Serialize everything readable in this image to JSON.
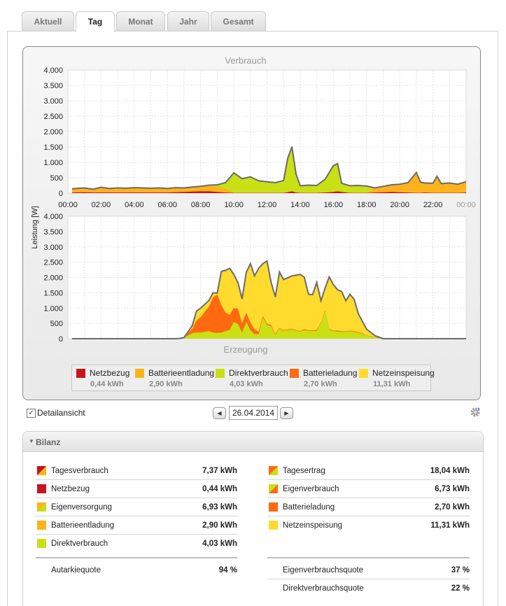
{
  "tabs": [
    "Aktuell",
    "Tag",
    "Monat",
    "Jahr",
    "Gesamt"
  ],
  "active_tab": 1,
  "colors": {
    "netzbezug": "#c8141c",
    "batterieentladung": "#ffb31a",
    "direktverbrauch": "#c9e014",
    "batterieladung": "#ff6a10",
    "netzeinspeisung": "#ffdb2e",
    "total_line": "#6b6b6b"
  },
  "chart": {
    "title_top": "Verbrauch",
    "title_bottom": "Erzeugung",
    "ylabel": "Leistung [W]",
    "legend": [
      {
        "name": "Netzbezug",
        "value": "0,44 kWh",
        "color": "#c8141c"
      },
      {
        "name": "Batterieentladung",
        "value": "2,90 kWh",
        "color": "#ffb31a"
      },
      {
        "name": "Direktverbrauch",
        "value": "4,03 kWh",
        "color": "#c9e014"
      },
      {
        "name": "Batterieladung",
        "value": "2,70 kWh",
        "color": "#ff6a10"
      },
      {
        "name": "Netzeinspeisung",
        "value": "11,31 kWh",
        "color": "#ffdb2e"
      }
    ]
  },
  "chart_data": [
    {
      "type": "area",
      "title": "Verbrauch",
      "ylabel": "Leistung [W]",
      "xlabel": "",
      "x_ticks": [
        "00:00",
        "02:00",
        "04:00",
        "06:00",
        "08:00",
        "10:00",
        "12:00",
        "14:00",
        "16:00",
        "18:00",
        "20:00",
        "22:00",
        "00:00"
      ],
      "y_ticks": [
        "0",
        "500",
        "1.000",
        "1.500",
        "2.000",
        "2.500",
        "3.000",
        "3.500",
        "4.000"
      ],
      "ylim": [
        0,
        4000
      ],
      "xlim_hours": [
        0,
        24
      ],
      "grid": true,
      "stacked": true,
      "x": [
        0.25,
        1,
        1.5,
        2,
        2.5,
        3,
        3.5,
        4,
        4.5,
        5,
        5.5,
        6,
        6.5,
        7,
        7.5,
        8,
        8.5,
        9,
        9.5,
        10,
        10.5,
        11,
        11.5,
        12,
        12.5,
        13,
        13.25,
        13.5,
        13.75,
        14,
        14.5,
        15,
        15.5,
        16,
        16.25,
        16.5,
        17,
        17.5,
        18,
        18.5,
        19,
        19.5,
        20,
        20.5,
        21,
        21.25,
        21.5,
        22,
        22.25,
        22.5,
        23,
        23.5,
        24
      ],
      "series": [
        {
          "name": "Netzbezug",
          "values": [
            20,
            30,
            20,
            20,
            20,
            20,
            20,
            20,
            20,
            20,
            20,
            20,
            30,
            40,
            50,
            60,
            60,
            40,
            20,
            10,
            10,
            10,
            10,
            10,
            10,
            10,
            30,
            60,
            20,
            10,
            10,
            10,
            20,
            40,
            60,
            40,
            10,
            10,
            10,
            20,
            30,
            40,
            30,
            20,
            10,
            10,
            20,
            10,
            10,
            10,
            10,
            10,
            20
          ]
        },
        {
          "name": "Batterieentladung",
          "values": [
            120,
            140,
            110,
            170,
            130,
            150,
            140,
            160,
            150,
            140,
            150,
            130,
            150,
            130,
            150,
            150,
            170,
            150,
            120,
            0,
            0,
            0,
            0,
            0,
            0,
            0,
            0,
            0,
            0,
            0,
            0,
            0,
            0,
            0,
            0,
            0,
            0,
            0,
            0,
            150,
            190,
            230,
            260,
            320,
            660,
            350,
            310,
            310,
            540,
            300,
            320,
            280,
            350
          ]
        },
        {
          "name": "Direktverbrauch",
          "values": [
            0,
            0,
            0,
            0,
            0,
            0,
            0,
            0,
            0,
            0,
            0,
            0,
            0,
            0,
            0,
            10,
            30,
            80,
            200,
            650,
            460,
            520,
            390,
            360,
            330,
            400,
            1100,
            1450,
            600,
            230,
            250,
            240,
            430,
            850,
            900,
            280,
            230,
            240,
            220,
            0,
            0,
            0,
            0,
            0,
            0,
            0,
            0,
            0,
            0,
            0,
            0,
            0,
            0
          ]
        }
      ]
    },
    {
      "type": "area",
      "title": "Erzeugung",
      "ylabel": "Leistung [W]",
      "xlabel": "",
      "y_ticks": [
        "0",
        "500",
        "1.000",
        "1.500",
        "2.000",
        "2.500",
        "3.000",
        "3.500",
        "4.000"
      ],
      "ylim": [
        0,
        4000
      ],
      "xlim_hours": [
        0,
        24
      ],
      "grid": true,
      "stacked": true,
      "x": [
        0.25,
        6.5,
        6.75,
        7,
        7.5,
        7.75,
        8,
        8.5,
        8.75,
        9,
        9.25,
        9.5,
        9.75,
        10,
        10.25,
        10.5,
        10.75,
        11,
        11.25,
        11.5,
        11.75,
        12,
        12.25,
        12.5,
        12.75,
        13,
        13.5,
        14,
        14.25,
        14.5,
        14.75,
        15,
        15.25,
        15.5,
        15.75,
        16,
        16.25,
        16.5,
        16.75,
        17,
        17.25,
        17.5,
        17.75,
        18,
        18.5,
        19,
        20,
        22,
        24
      ],
      "series": [
        {
          "name": "Direktverbrauch",
          "values": [
            0,
            0,
            10,
            40,
            180,
            200,
            200,
            250,
            200,
            190,
            200,
            250,
            280,
            550,
            480,
            200,
            550,
            280,
            150,
            150,
            700,
            450,
            400,
            130,
            330,
            260,
            300,
            230,
            280,
            260,
            250,
            260,
            520,
            900,
            300,
            250,
            240,
            220,
            230,
            240,
            220,
            200,
            150,
            100,
            50,
            0,
            0,
            0,
            0
          ]
        },
        {
          "name": "Batterieladung",
          "values": [
            0,
            0,
            0,
            0,
            150,
            400,
            500,
            800,
            1150,
            1250,
            900,
            600,
            500,
            450,
            500,
            300,
            300,
            250,
            150,
            80,
            50,
            40,
            40,
            30,
            20,
            20,
            20,
            20,
            30,
            20,
            20,
            30,
            20,
            20,
            20,
            20,
            30,
            20,
            20,
            20,
            20,
            20,
            20,
            10,
            10,
            0,
            0,
            0,
            0
          ]
        },
        {
          "name": "Netzeinspeisung",
          "values": [
            0,
            0,
            0,
            0,
            100,
            300,
            300,
            200,
            150,
            50,
            1100,
            1380,
            1520,
            1100,
            850,
            800,
            1320,
            1920,
            1750,
            2070,
            1700,
            2050,
            1400,
            1200,
            1830,
            1650,
            1730,
            1850,
            1700,
            1170,
            1170,
            1550,
            700,
            730,
            1700,
            1500,
            1330,
            1300,
            990,
            1190,
            1050,
            600,
            400,
            200,
            40,
            0,
            0,
            0,
            0
          ]
        }
      ]
    }
  ],
  "controls": {
    "detailansicht_label": "Detailansicht",
    "detailansicht_checked": "✓",
    "date": "26.04.2014",
    "prev": "◀",
    "next": "▶"
  },
  "bilanz": {
    "title": "Bilanz",
    "left": [
      {
        "label": "Tagesverbrauch",
        "value": "7,37 kWh",
        "swatch": [
          "#c8141c",
          "#ffb31a"
        ]
      },
      {
        "label": "Netzbezug",
        "value": "0,44 kWh",
        "swatch": [
          "#c8141c"
        ]
      },
      {
        "label": "Eigenversorgung",
        "value": "6,93 kWh",
        "swatch": [
          "#ffb31a",
          "#c9e014"
        ]
      },
      {
        "label": "Batterieentladung",
        "value": "2,90 kWh",
        "swatch": [
          "#ffb31a"
        ]
      },
      {
        "label": "Direktverbrauch",
        "value": "4,03 kWh",
        "swatch": [
          "#c9e014"
        ]
      }
    ],
    "right": [
      {
        "label": "Tagesertrag",
        "value": "18,04 kWh",
        "swatch": [
          "#ff6a10",
          "#c9e014"
        ]
      },
      {
        "label": "Eigenverbrauch",
        "value": "6,73 kWh",
        "swatch": [
          "#c9e014",
          "#ff6a10"
        ]
      },
      {
        "label": "Batterieladung",
        "value": "2,70 kWh",
        "swatch": [
          "#ff6a10"
        ]
      },
      {
        "label": "Netzeinspeisung",
        "value": "11,31 kWh",
        "swatch": [
          "#ffdb2e"
        ]
      }
    ],
    "left_quotas": [
      {
        "label": "Autarkiequote",
        "value": "94 %"
      }
    ],
    "right_quotas": [
      {
        "label": "Eigenverbrauchsquote",
        "value": "37 %"
      },
      {
        "label": "Direktverbrauchsquote",
        "value": "22 %"
      }
    ]
  }
}
